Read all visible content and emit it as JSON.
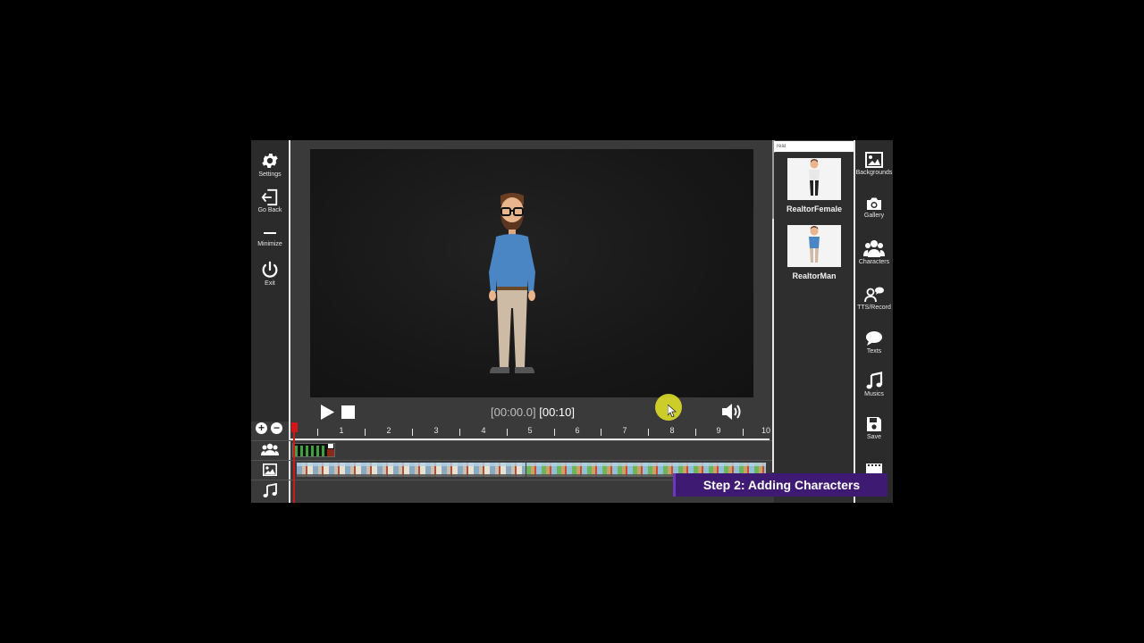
{
  "left_toolbar": {
    "items": [
      {
        "label": "Settings",
        "icon": "gear-icon"
      },
      {
        "label": "Go Back",
        "icon": "go-back-icon"
      },
      {
        "label": "Minimize",
        "icon": "minimize-icon"
      },
      {
        "label": "Exit",
        "icon": "power-icon"
      }
    ]
  },
  "player": {
    "time_current": "[00:00.0]",
    "time_total": "[00:10]"
  },
  "timeline": {
    "zoom_in": "+",
    "zoom_out": "−",
    "ticks": [
      "1",
      "2",
      "3",
      "4",
      "5",
      "6",
      "7",
      "8",
      "9",
      "10"
    ],
    "tracks": [
      "characters-track-icon",
      "image-track-icon",
      "music-track-icon"
    ]
  },
  "search": {
    "value": "real"
  },
  "library": {
    "items": [
      {
        "label": "RealtorFemale"
      },
      {
        "label": "RealtorMan"
      }
    ]
  },
  "right_toolbar": {
    "items": [
      {
        "label": "Backgrounds",
        "icon": "image-icon"
      },
      {
        "label": "Gallery",
        "icon": "camera-icon"
      },
      {
        "label": "Characters",
        "icon": "users-icon"
      },
      {
        "label": "TTS/Record",
        "icon": "speech-record-icon"
      },
      {
        "label": "Texts",
        "icon": "chat-bubble-icon"
      },
      {
        "label": "Musics",
        "icon": "music-note-icon"
      },
      {
        "label": "Save",
        "icon": "floppy-disk-icon"
      }
    ]
  },
  "banner": {
    "text": "Step 2: Adding Characters"
  },
  "colors": {
    "playhead": "#d01818",
    "banner": "#3f1a73",
    "cursor_highlight": "#e6e628"
  }
}
